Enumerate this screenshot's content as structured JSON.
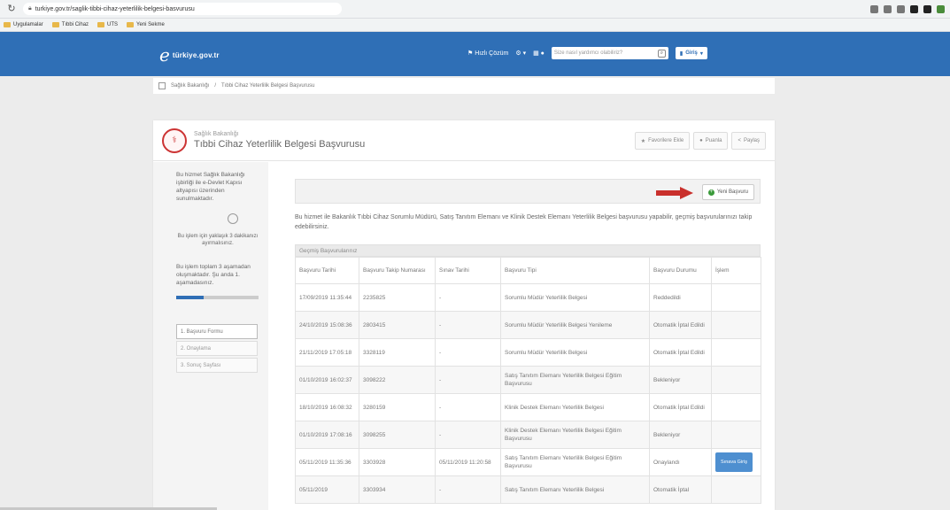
{
  "browser": {
    "url": "turkiye.gov.tr/saglik-tibbi-cihaz-yeterlilik-belgesi-basvurusu",
    "bookmarks": [
      "Uygulamalar",
      "Tıbbi Cihaz",
      "UTS",
      "Yeni Sekme"
    ]
  },
  "header": {
    "logo_text": "türkiye.gov.tr",
    "nav_label": "Hızlı Çözüm",
    "search_placeholder": "Size nasıl yardımcı olabiliriz?",
    "login_label": "Giriş"
  },
  "breadcrumb": {
    "items": [
      "Sağlık Bakanlığı",
      "Tıbbi Cihaz Yeterlilik Belgesi Başvurusu"
    ]
  },
  "card": {
    "ministry": "Sağlık Bakanlığı",
    "title": "Tıbbi Cihaz Yeterlilik Belgesi Başvurusu",
    "actions": [
      "Favorilere Ekle",
      "Puanla",
      "Paylaş"
    ]
  },
  "sidebar": {
    "info": "Bu hizmet Sağlık Bakanlığı işbirliği ile e-Devlet Kapısı altyapısı üzerinden sunulmaktadır.",
    "time": "Bu işlem için yaklaşık 3 dakikanızı ayırmalısınız.",
    "step_info": "Bu işlem toplam 3 aşamadan oluşmaktadır. Şu anda 1. aşamadasınız.",
    "progress": 0.33,
    "steps": [
      "1. Başvuru Formu",
      "2. Onaylama",
      "3. Sonuç Sayfası"
    ]
  },
  "content": {
    "new_button": "Yeni Başvuru",
    "description": "Bu hizmet ile Bakanlık Tıbbi Cihaz Sorumlu Müdürü, Satış Tanıtım Elemanı ve Klinik Destek Elemanı Yeterlilik Belgesi başvurusu yapabilir, geçmiş başvurularınızı takip edebilirsiniz.",
    "table_title": "Geçmiş Başvurularınız",
    "columns": [
      "Başvuru Tarihi",
      "Başvuru Takip Numarası",
      "Sınav Tarihi",
      "Başvuru Tipi",
      "Başvuru Durumu",
      "İşlem"
    ],
    "rows": [
      {
        "date": "17/09/2019 11:35:44",
        "no": "2235825",
        "exam": "-",
        "type": "Sorumlu Müdür Yeterlilik Belgesi",
        "status": "Reddedildi",
        "action": ""
      },
      {
        "date": "24/10/2019 15:08:36",
        "no": "2803415",
        "exam": "-",
        "type": "Sorumlu Müdür Yeterlilik Belgesi Yenileme",
        "status": "Otomatik İptal Edildi",
        "action": ""
      },
      {
        "date": "21/11/2019 17:05:18",
        "no": "3328119",
        "exam": "-",
        "type": "Sorumlu Müdür Yeterlilik Belgesi",
        "status": "Otomatik İptal Edildi",
        "action": ""
      },
      {
        "date": "01/10/2019 16:02:37",
        "no": "3098222",
        "exam": "-",
        "type": "Satış Tanıtım Elemanı Yeterlilik Belgesi Eğitim Başvurusu",
        "status": "Bekleniyor",
        "action": ""
      },
      {
        "date": "18/10/2019 16:08:32",
        "no": "3280159",
        "exam": "-",
        "type": "Klinik Destek Elemanı Yeterlilik Belgesi",
        "status": "Otomatik İptal Edildi",
        "action": ""
      },
      {
        "date": "01/10/2019 17:08:16",
        "no": "3098255",
        "exam": "-",
        "type": "Klinik Destek Elemanı Yeterlilik Belgesi Eğitim Başvurusu",
        "status": "Bekleniyor",
        "action": ""
      },
      {
        "date": "05/11/2019 11:35:36",
        "no": "3303928",
        "exam": "05/11/2019 11:20:58",
        "type": "Satış Tanıtım Elemanı Yeterlilik Belgesi Eğitim Başvurusu",
        "status": "Onaylandı",
        "action": "Sınava Giriş"
      },
      {
        "date": "05/11/2019",
        "no": "3303934",
        "exam": "-",
        "type": "Satış Tanıtım Elemanı Yeterlilik Belgesi",
        "status": "Otomatik İptal",
        "action": ""
      }
    ]
  },
  "colors": {
    "header_blue": "#2f6fb6",
    "arrow_red": "#c9302c",
    "plus_green": "#3a9a3a",
    "action_blue": "#4e8fd0"
  }
}
